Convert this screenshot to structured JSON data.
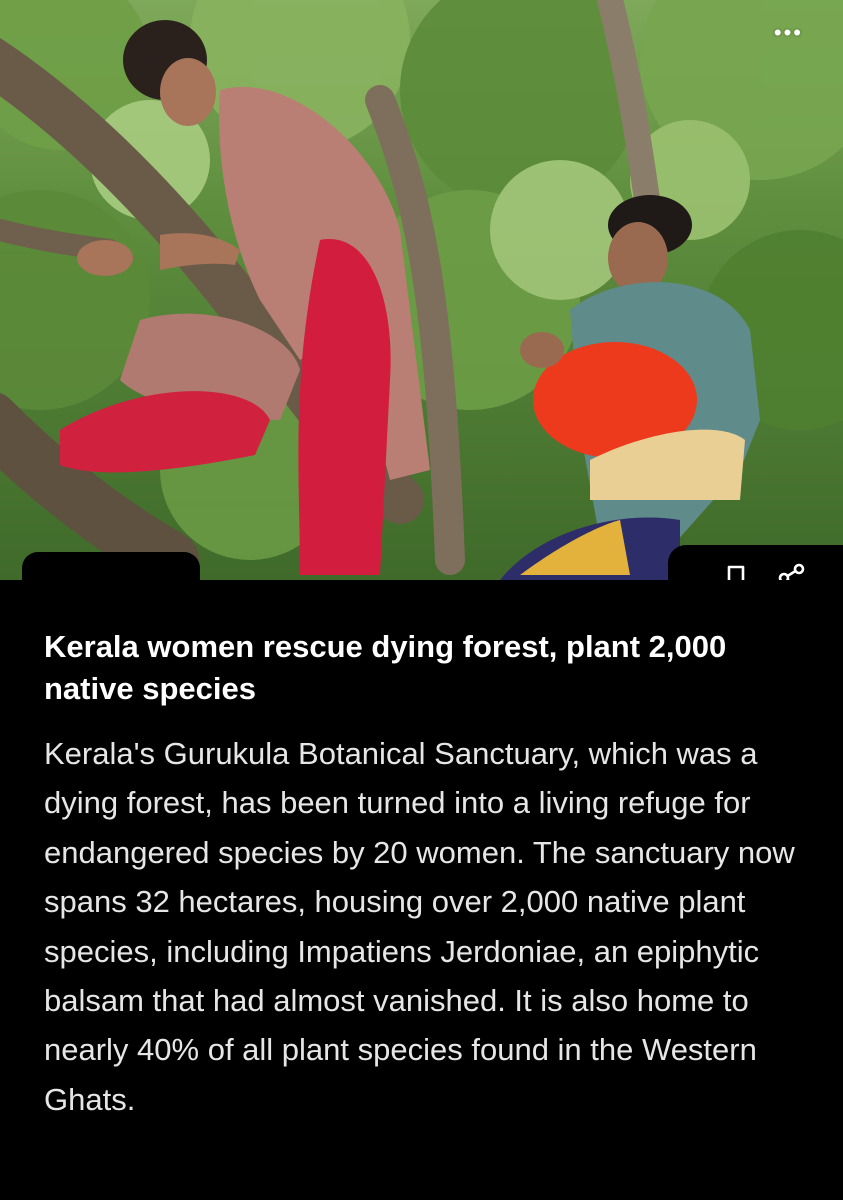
{
  "article": {
    "headline": "Kerala women rescue dying forest, plant 2,000 native species",
    "body": "Kerala's Gurukula Botanical Sanctuary, which was a dying forest, has been turned into a living refuge for endangered species by 20 women. The sanctuary now spans 32 hectares, housing over 2,000 native plant species, including Impatiens Jerdoniae, an epiphytic balsam that had almost vanished. It is also home to nearly 40% of all plant species found in the Western Ghats."
  },
  "toolbar": {
    "more_label": "•••",
    "bookmark_icon": "bookmark-icon",
    "share_icon": "share-icon"
  },
  "colors": {
    "background": "#000000",
    "headline": "#ffffff",
    "body": "#e6e6e6",
    "foliage": "#5f8f3e"
  }
}
